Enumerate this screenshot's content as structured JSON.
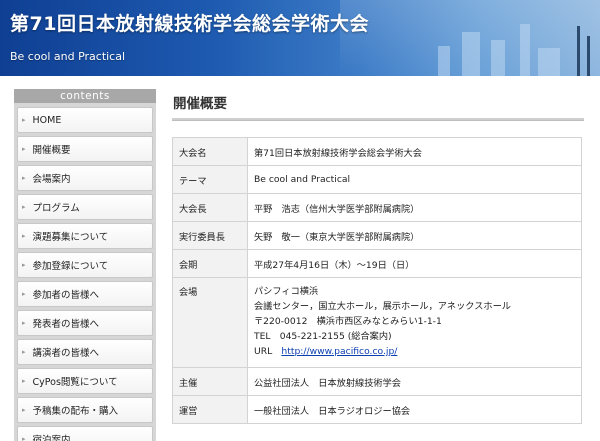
{
  "header": {
    "title": "第71回日本放射線技術学会総会学術大会",
    "subtitle": "Be cool and Practical"
  },
  "sidebar": {
    "heading": "contents",
    "items": [
      {
        "label": "HOME"
      },
      {
        "label": "開催概要"
      },
      {
        "label": "会場案内"
      },
      {
        "label": "プログラム"
      },
      {
        "label": "演題募集について"
      },
      {
        "label": "参加登録について"
      },
      {
        "label": "参加者の皆様へ"
      },
      {
        "label": "発表者の皆様へ"
      },
      {
        "label": "講演者の皆様へ"
      },
      {
        "label": "CyPos閲覧について"
      },
      {
        "label": "予稿集の配布・購入"
      },
      {
        "label": "宿泊案内"
      }
    ]
  },
  "main": {
    "heading": "開催概要",
    "rows": [
      {
        "key": "大会名",
        "value": "第71回日本放射線技術学会総会学術大会"
      },
      {
        "key": "テーマ",
        "value": "Be cool and Practical"
      },
      {
        "key": "大会長",
        "value": "平野　浩志（信州大学医学部附属病院）"
      },
      {
        "key": "実行委員長",
        "value": "矢野　敬一（東京大学医学部附属病院）"
      },
      {
        "key": "会期",
        "value": "平成27年4月16日（木）〜19日（日）"
      }
    ],
    "venue": {
      "key": "会場",
      "lines": [
        "パシフィコ横浜",
        "会議センター，国立大ホール，展示ホール，アネックスホール",
        "〒220-0012　横浜市西区みなとみらい1-1-1",
        "TEL　045-221-2155 (総合案内)"
      ],
      "url_label": "URL",
      "url": "http://www.pacifico.co.jp/"
    },
    "rows2": [
      {
        "key": "主催",
        "value": "公益社団法人　日本放射線技術学会"
      },
      {
        "key": "運営",
        "value": "一般社団法人　日本ラジオロジー協会"
      }
    ]
  }
}
